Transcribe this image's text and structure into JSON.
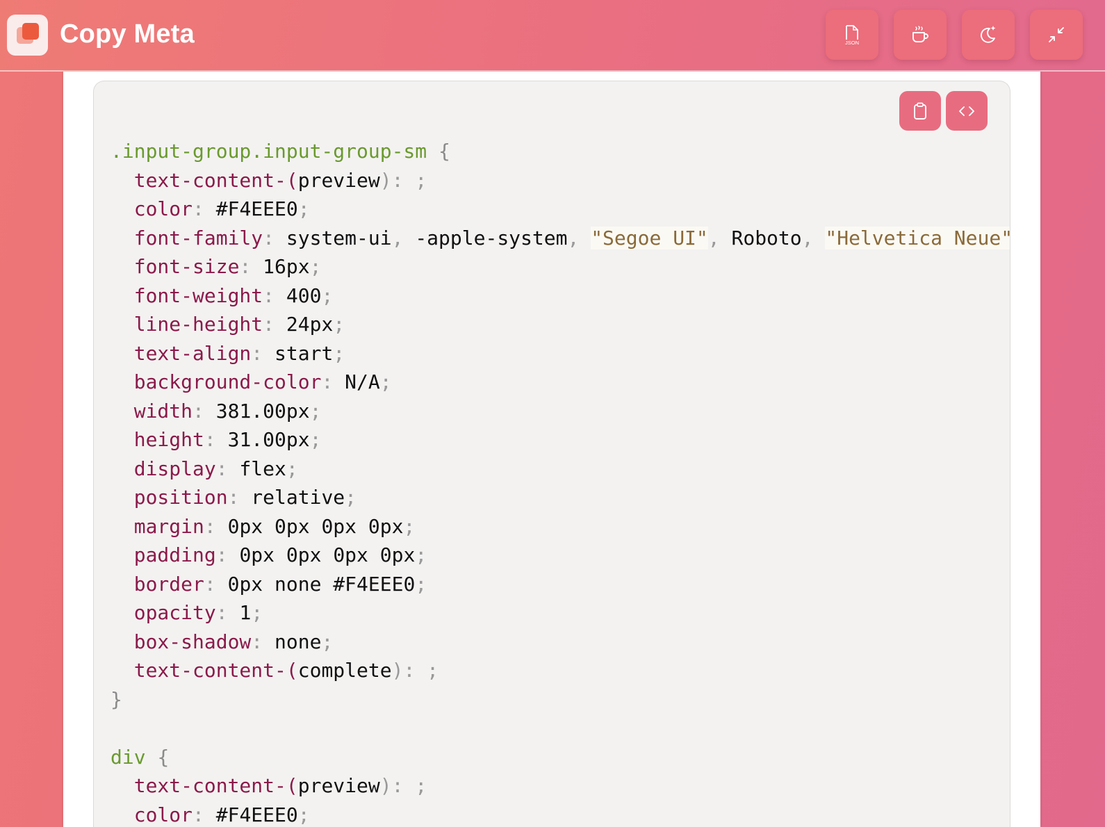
{
  "app": {
    "title": "Copy Meta"
  },
  "header_buttons": [
    {
      "icon": "json-file-icon",
      "label": "JSON"
    },
    {
      "icon": "coffee-cup-icon"
    },
    {
      "icon": "dark-mode-icon"
    },
    {
      "icon": "minimize-icon"
    }
  ],
  "code_actions": [
    {
      "icon": "clipboard-icon"
    },
    {
      "icon": "code-icon"
    }
  ],
  "colors": {
    "accent": "#E86C80",
    "code_bg": "#F3F2F1",
    "selector": "#6A9A2E",
    "property": "#8B1A4A",
    "string": "#8A6A3A"
  },
  "code_blocks": [
    {
      "selector": ".input-group.input-group-sm",
      "open": "{",
      "close": "}",
      "decls": [
        {
          "prop": "text-content-",
          "open_paren": "(",
          "arg": "preview",
          "close_paren": ")",
          "colon": ": ",
          "semi": ";"
        },
        {
          "prop": "color",
          "value": "#F4EEE0"
        },
        {
          "prop": "font-family",
          "font_parts": [
            {
              "t": "system-ui",
              "k": "val"
            },
            {
              "t": ", ",
              "k": "punc"
            },
            {
              "t": "-apple-system",
              "k": "val"
            },
            {
              "t": ", ",
              "k": "punc"
            },
            {
              "t": "\"Segoe UI\"",
              "k": "str"
            },
            {
              "t": ", ",
              "k": "punc"
            },
            {
              "t": "Roboto",
              "k": "val"
            },
            {
              "t": ", ",
              "k": "punc"
            },
            {
              "t": "\"Helvetica Neue\"",
              "k": "str"
            }
          ]
        },
        {
          "prop": "font-size",
          "value": "16px"
        },
        {
          "prop": "font-weight",
          "value": "400"
        },
        {
          "prop": "line-height",
          "value": "24px"
        },
        {
          "prop": "text-align",
          "value": "start"
        },
        {
          "prop": "background-color",
          "value": "N/A"
        },
        {
          "prop": "width",
          "value": "381.00px"
        },
        {
          "prop": "height",
          "value": "31.00px"
        },
        {
          "prop": "display",
          "value": "flex"
        },
        {
          "prop": "position",
          "value": "relative"
        },
        {
          "prop": "margin",
          "value": "0px 0px 0px 0px"
        },
        {
          "prop": "padding",
          "value": "0px 0px 0px 0px"
        },
        {
          "prop": "border",
          "value": "0px none #F4EEE0"
        },
        {
          "prop": "opacity",
          "value": "1"
        },
        {
          "prop": "box-shadow",
          "value": "none"
        },
        {
          "prop": "text-content-",
          "open_paren": "(",
          "arg": "complete",
          "close_paren": ")",
          "colon": ": ",
          "semi": ";"
        }
      ]
    },
    {
      "selector": "div",
      "open": "{",
      "decls": [
        {
          "prop": "text-content-",
          "open_paren": "(",
          "arg": "preview",
          "close_paren": ")",
          "colon": ": ",
          "semi": ";"
        },
        {
          "prop": "color",
          "value": "#F4EEE0"
        }
      ]
    }
  ]
}
